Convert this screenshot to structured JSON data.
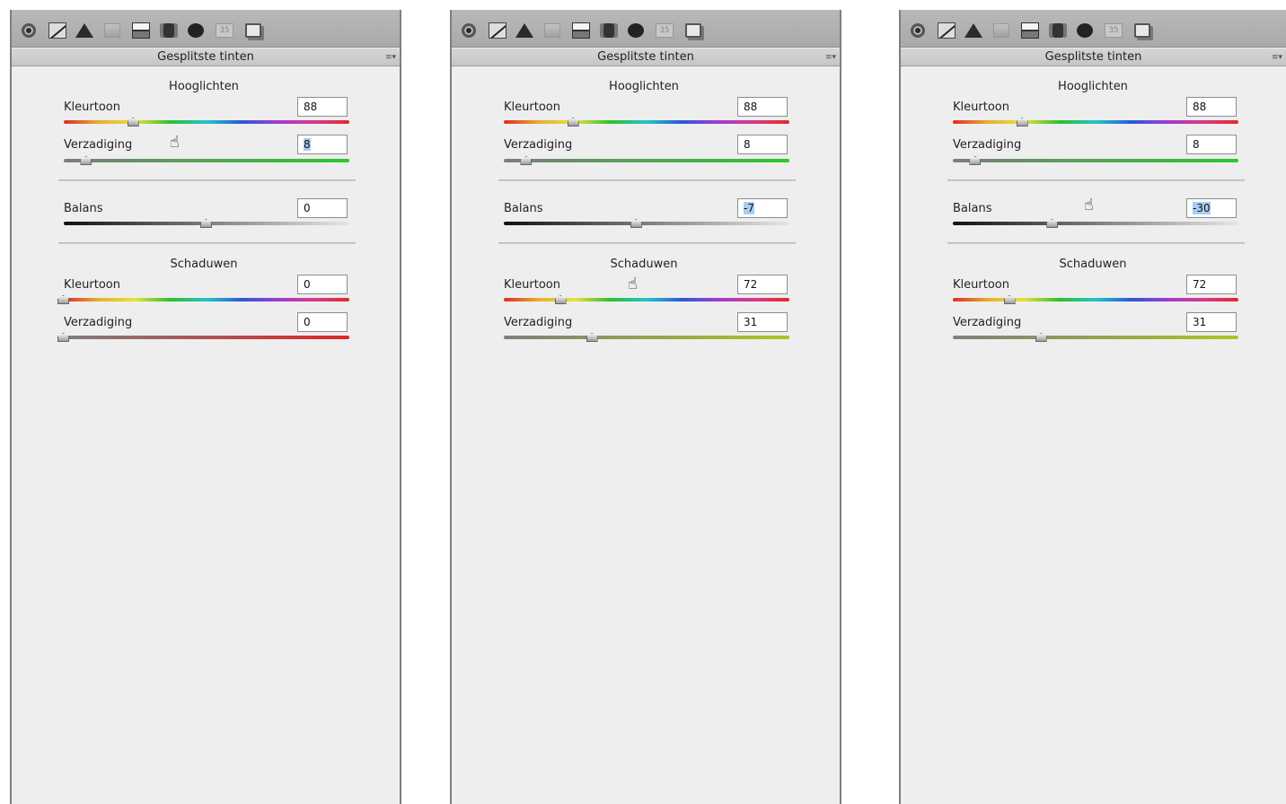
{
  "panels": [
    {
      "header": "Gesplitste tinten",
      "highlights": {
        "title": "Hooglichten",
        "hue_label": "Kleurtoon",
        "hue_value": "88",
        "sat_label": "Verzadiging",
        "sat_value": "8"
      },
      "balance": {
        "label": "Balans",
        "value": "0"
      },
      "shadows": {
        "title": "Schaduwen",
        "hue_label": "Kleurtoon",
        "hue_value": "0",
        "sat_label": "Verzadiging",
        "sat_value": "0"
      },
      "slider_levels": {
        "hl_hue": 88,
        "hl_sat": 8,
        "balance": 0,
        "sh_hue": 0,
        "sh_sat": 0
      },
      "selected_field": "hl_sat"
    },
    {
      "header": "Gesplitste tinten",
      "highlights": {
        "title": "Hooglichten",
        "hue_label": "Kleurtoon",
        "hue_value": "88",
        "sat_label": "Verzadiging",
        "sat_value": "8"
      },
      "balance": {
        "label": "Balans",
        "value": "-7"
      },
      "shadows": {
        "title": "Schaduwen",
        "hue_label": "Kleurtoon",
        "hue_value": "72",
        "sat_label": "Verzadiging",
        "sat_value": "31"
      },
      "slider_levels": {
        "hl_hue": 88,
        "hl_sat": 8,
        "balance": -7,
        "sh_hue": 72,
        "sh_sat": 31
      },
      "selected_field": "balance"
    },
    {
      "header": "Gesplitste tinten",
      "highlights": {
        "title": "Hooglichten",
        "hue_label": "Kleurtoon",
        "hue_value": "88",
        "sat_label": "Verzadiging",
        "sat_value": "8"
      },
      "balance": {
        "label": "Balans",
        "value": "-30"
      },
      "shadows": {
        "title": "Schaduwen",
        "hue_label": "Kleurtoon",
        "hue_value": "72",
        "sat_label": "Verzadiging",
        "sat_value": "31"
      },
      "slider_levels": {
        "hl_hue": 88,
        "hl_sat": 8,
        "balance": -30,
        "sh_hue": 72,
        "sh_sat": 31
      },
      "selected_field": "balance"
    }
  ],
  "toolbar_icons": [
    "aperture-icon",
    "tone-curve-icon",
    "detail-icon",
    "hsl-grayscale-icon",
    "split-toning-icon",
    "lens-corrections-icon",
    "effects-icon",
    "camera-calibration-icon",
    "presets-icon"
  ],
  "menu_glyph": "≡▾",
  "cursor_glyph": "☝",
  "colors": {
    "panel_bg": "#eeeeee",
    "toolbar_bg": "#b0b0b0",
    "selection": "#a9cdf2"
  }
}
